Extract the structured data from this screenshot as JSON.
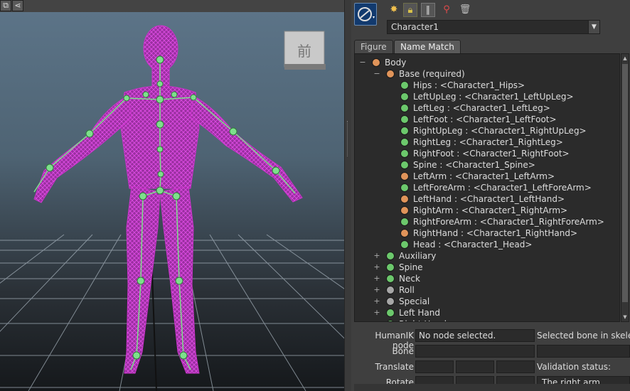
{
  "viewport": {
    "cube_label": "前",
    "bg_colors": {
      "top": "#5d7589",
      "bottom": "#15181b",
      "mesh": "#cc33cc",
      "joint": "#7ee08c"
    }
  },
  "toolbar": {
    "icons": [
      "humanik-logo-icon",
      "star-icon",
      "lock-icon",
      "skeleton-icon",
      "pin-tool-icon",
      "trash-icon"
    ]
  },
  "character_select": {
    "value": "Character1"
  },
  "tabs": [
    {
      "label": "Figure",
      "active": false
    },
    {
      "label": "Name Match",
      "active": true
    }
  ],
  "colors": {
    "green": "#6cc86c",
    "orange": "#e0945a",
    "gray": "#a7a7a7"
  },
  "tree": [
    {
      "label": "Body",
      "dot": "orange",
      "expander": "−",
      "level": 0
    },
    {
      "label": "Base (required)",
      "dot": "orange",
      "expander": "−",
      "level": 1
    },
    {
      "label": "Hips : <Character1_Hips>",
      "dot": "green",
      "expander": "",
      "level": 2
    },
    {
      "label": "LeftUpLeg : <Character1_LeftUpLeg>",
      "dot": "green",
      "expander": "",
      "level": 2
    },
    {
      "label": "LeftLeg : <Character1_LeftLeg>",
      "dot": "green",
      "expander": "",
      "level": 2
    },
    {
      "label": "LeftFoot : <Character1_LeftFoot>",
      "dot": "green",
      "expander": "",
      "level": 2
    },
    {
      "label": "RightUpLeg : <Character1_RightUpLeg>",
      "dot": "green",
      "expander": "",
      "level": 2
    },
    {
      "label": "RightLeg : <Character1_RightLeg>",
      "dot": "green",
      "expander": "",
      "level": 2
    },
    {
      "label": "RightFoot : <Character1_RightFoot>",
      "dot": "green",
      "expander": "",
      "level": 2
    },
    {
      "label": "Spine : <Character1_Spine>",
      "dot": "green",
      "expander": "",
      "level": 2
    },
    {
      "label": "LeftArm : <Character1_LeftArm>",
      "dot": "orange",
      "expander": "",
      "level": 2
    },
    {
      "label": "LeftForeArm : <Character1_LeftForeArm>",
      "dot": "green",
      "expander": "",
      "level": 2
    },
    {
      "label": "LeftHand : <Character1_LeftHand>",
      "dot": "orange",
      "expander": "",
      "level": 2
    },
    {
      "label": "RightArm : <Character1_RightArm>",
      "dot": "orange",
      "expander": "",
      "level": 2
    },
    {
      "label": "RightForeArm : <Character1_RightForeArm>",
      "dot": "green",
      "expander": "",
      "level": 2
    },
    {
      "label": "RightHand : <Character1_RightHand>",
      "dot": "orange",
      "expander": "",
      "level": 2
    },
    {
      "label": "Head : <Character1_Head>",
      "dot": "green",
      "expander": "",
      "level": 2
    },
    {
      "label": "Auxiliary",
      "dot": "green",
      "expander": "+",
      "level": 1
    },
    {
      "label": "Spine",
      "dot": "green",
      "expander": "+",
      "level": 1
    },
    {
      "label": "Neck",
      "dot": "green",
      "expander": "+",
      "level": 1
    },
    {
      "label": "Roll",
      "dot": "gray",
      "expander": "+",
      "level": 1
    },
    {
      "label": "Special",
      "dot": "gray",
      "expander": "+",
      "level": 1
    },
    {
      "label": "Left Hand",
      "dot": "green",
      "expander": "+",
      "level": 1
    },
    {
      "label": "Right Hand",
      "dot": "green",
      "expander": "+",
      "level": 1
    }
  ],
  "fields": {
    "humanik_node_label": "HumanIK node",
    "humanik_node_value": "No node selected.",
    "selected_bone_label": "Selected bone in skeleton",
    "bone_label": "Bone",
    "translate_label": "Translate",
    "rotate_label": "Rotate",
    "validation_label": "Validation status:",
    "validation_value": "The right arm"
  }
}
